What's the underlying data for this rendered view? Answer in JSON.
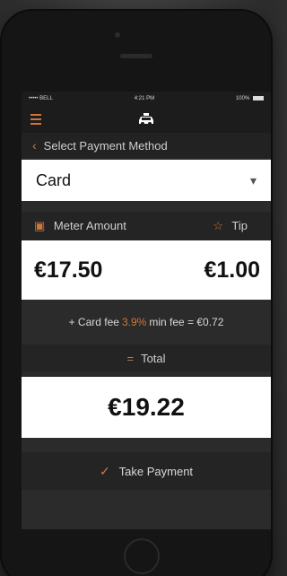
{
  "status_bar": {
    "carrier": "••••• BELL",
    "time": "4:21 PM",
    "battery": "100%"
  },
  "nav": {
    "menu_icon": "menu-icon",
    "logo_icon": "taxi-icon"
  },
  "payment_method": {
    "label": "Select Payment Method",
    "selected": "Card"
  },
  "amounts": {
    "meter_label": "Meter Amount",
    "tip_label": "Tip",
    "meter_value": "€17.50",
    "tip_value": "€1.00"
  },
  "fee": {
    "prefix": "+ Card fee",
    "rate": "3.9%",
    "suffix": "min fee = €0.72"
  },
  "total": {
    "label": "Total",
    "value": "€19.22"
  },
  "action": {
    "label": "Take Payment"
  },
  "colors": {
    "accent": "#d0763b",
    "background": "#2b2b2b"
  }
}
